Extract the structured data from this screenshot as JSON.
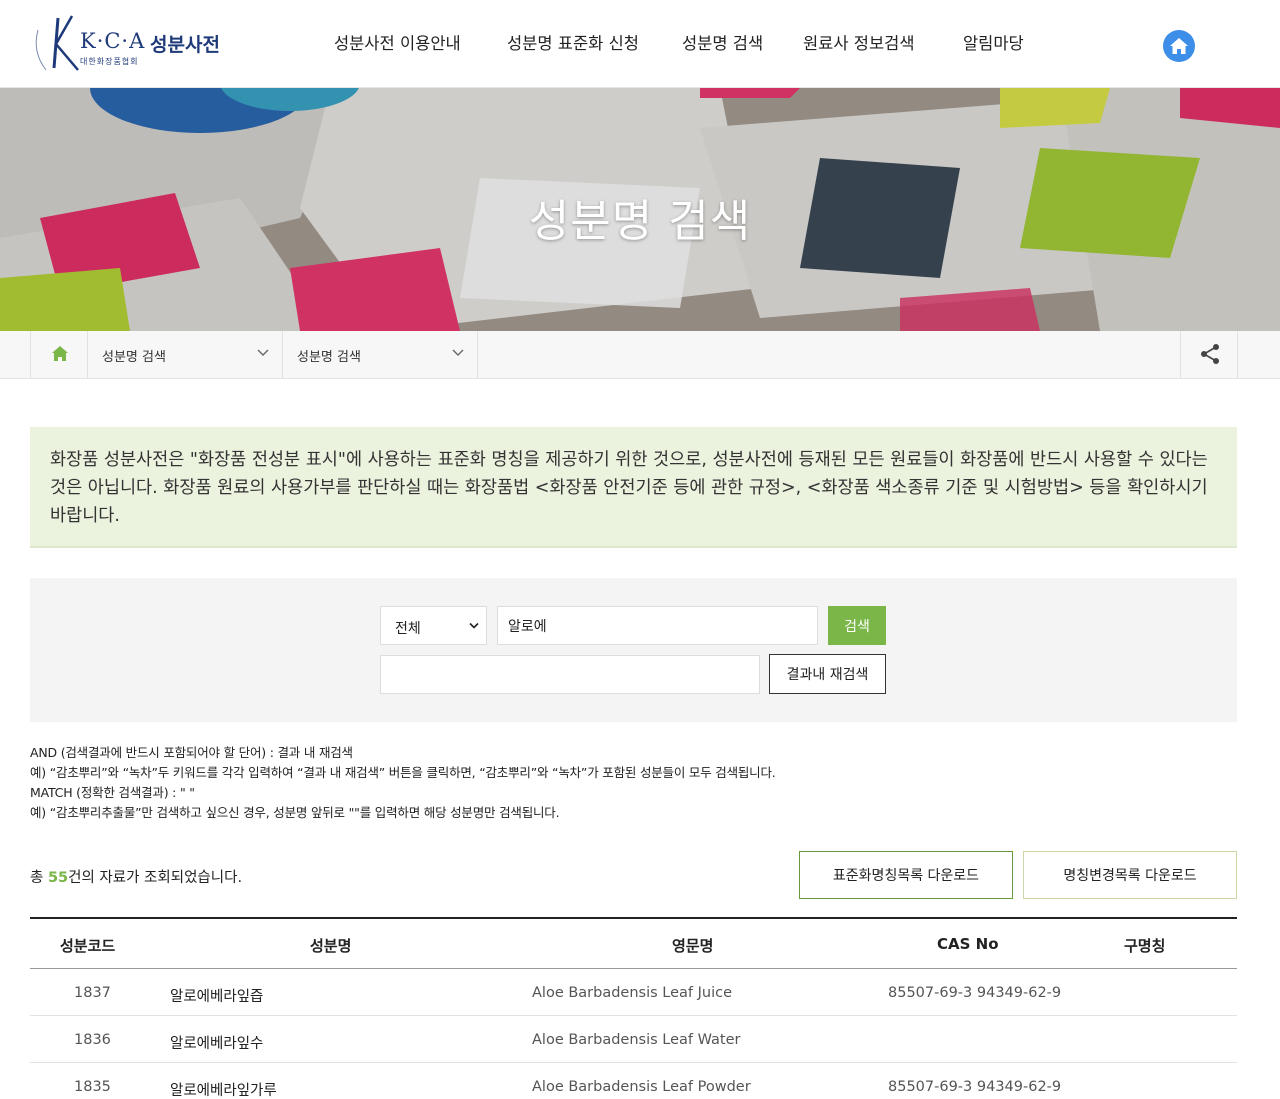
{
  "header": {
    "logo_text": "K·C·A",
    "logo_title": "성분사전",
    "logo_sub": "대한화장품협회",
    "nav": [
      {
        "label": "성분사전 이용안내"
      },
      {
        "label": "성분명 표준화 신청"
      },
      {
        "label": "성분명 검색"
      },
      {
        "label": "원료사 정보검색"
      },
      {
        "label": "알림마당"
      }
    ],
    "home_icon": "home-icon"
  },
  "hero": {
    "title": "성분명 검색"
  },
  "breadcrumb": {
    "home_icon": "home-icon",
    "level1": "성분명 검색",
    "level2": "성분명 검색",
    "share_icon": "share-icon"
  },
  "notice": {
    "text": "화장품 성분사전은 \"화장품 전성분 표시\"에 사용하는 표준화 명칭을 제공하기 위한 것으로, 성분사전에 등재된 모든 원료들이 화장품에 반드시 사용할 수 있다는 것은 아닙니다. 화장품 원료의 사용가부를 판단하실 때는 화장품법 <화장품 안전기준 등에 관한 규정>, <화장품 색소종류 기준 및 시험방법> 등을 확인하시기 바랍니다."
  },
  "search": {
    "field_select": "전체",
    "keyword": "알로에",
    "search_label": "검색",
    "refine_value": "",
    "refine_label": "결과내 재검색"
  },
  "help": {
    "line1": "AND (검색결과에 반드시 포함되어야 할 단어) : 결과 내 재검색",
    "line2": "예) “감초뿌리”와 “녹차”두 키워드를 각각 입력하여 “결과 내 재검색” 버튼을 클릭하면, “감초뿌리”와 “녹차”가 포함된 성분들이 모두 검색됩니다.",
    "line3": "MATCH (정확한 검색결과) : \" \"",
    "line4": "예) “감초뿌리추출물”만 검색하고 싶으신 경우, 성분명 앞뒤로 \"\"를 입력하면 해당 성분명만 검색됩니다."
  },
  "result": {
    "prefix": "총 ",
    "count": "55",
    "suffix": "건의 자료가 조회되었습니다.",
    "download_standard": "표준화명칭목록 다운로드",
    "download_changed": "명칭변경목록 다운로드"
  },
  "table": {
    "headers": [
      "성분코드",
      "성분명",
      "영문명",
      "CAS No",
      "구명칭"
    ],
    "rows": [
      {
        "code": "1837",
        "name": "알로에베라잎즙",
        "eng": "Aloe Barbadensis Leaf Juice",
        "cas": "85507-69-3 94349-62-9",
        "old": ""
      },
      {
        "code": "1836",
        "name": "알로에베라잎수",
        "eng": "Aloe Barbadensis Leaf Water",
        "cas": "",
        "old": ""
      },
      {
        "code": "1835",
        "name": "알로에베라잎가루",
        "eng": "Aloe Barbadensis Leaf Powder",
        "cas": "85507-69-3 94349-62-9",
        "old": ""
      }
    ]
  },
  "colors": {
    "accent": "#7ab648",
    "notice_bg": "#ebf3df",
    "home_button": "#3d8ee8",
    "brand": "#1f3a7a"
  }
}
